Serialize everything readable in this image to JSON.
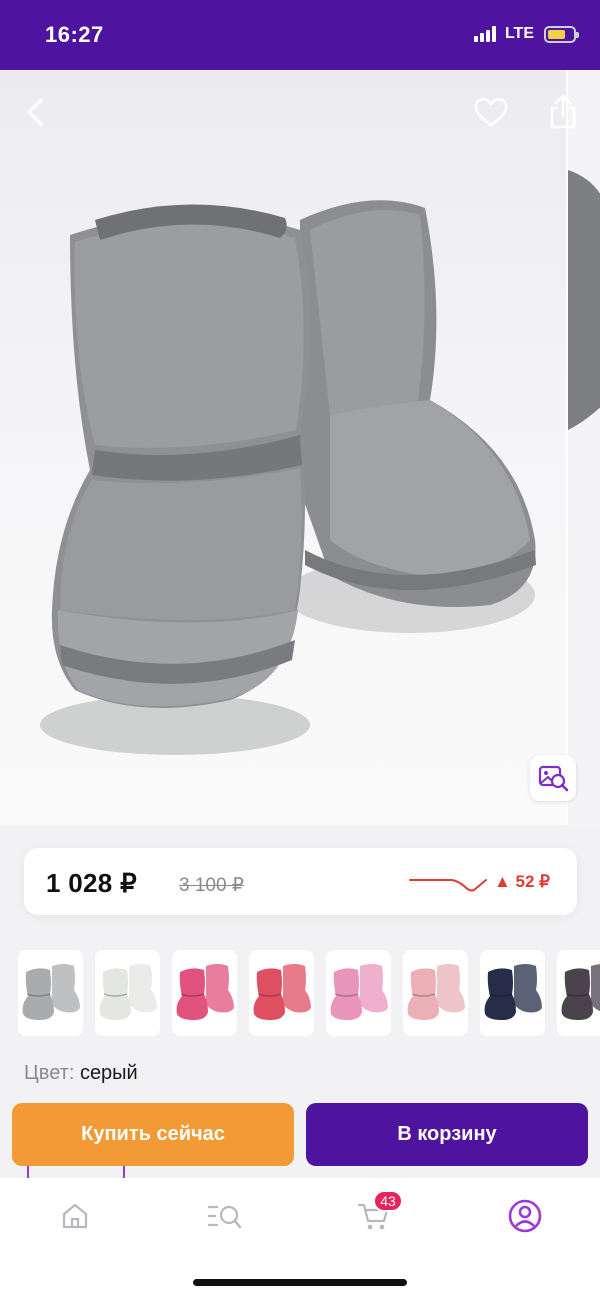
{
  "status_bar": {
    "time": "16:27",
    "network": "LTE",
    "battery_level": 0.7
  },
  "gallery": {
    "icons": {
      "back": "chevron-left-icon",
      "favorite": "heart-icon",
      "share": "share-icon",
      "visual_search": "image-search-icon"
    },
    "product_color_hex": "#8f9193"
  },
  "price": {
    "current": "1 028 ₽",
    "old": "3 100 ₽",
    "change": "▲ 52 ₽",
    "change_color": "#e03c31"
  },
  "variants": [
    {
      "color": "#a9abad"
    },
    {
      "color": "#e4e6e2"
    },
    {
      "color": "#e2527e"
    },
    {
      "color": "#df4f62"
    },
    {
      "color": "#e995b9"
    },
    {
      "color": "#eab0b6"
    },
    {
      "color": "#252d48"
    },
    {
      "color": "#4a434c"
    }
  ],
  "color": {
    "label": "Цвет:",
    "value": "серый"
  },
  "actions": {
    "buy_now": "Купить сейчас",
    "add_to_cart": "В корзину"
  },
  "tab_bar": {
    "items": [
      {
        "icon": "home-icon"
      },
      {
        "icon": "catalog-search-icon"
      },
      {
        "icon": "cart-icon",
        "badge": "43"
      },
      {
        "icon": "profile-icon",
        "active": true
      }
    ],
    "accent": "#9a3ad8"
  },
  "theme": {
    "brand": "#4e149f",
    "buy_now": "#f19a36"
  }
}
